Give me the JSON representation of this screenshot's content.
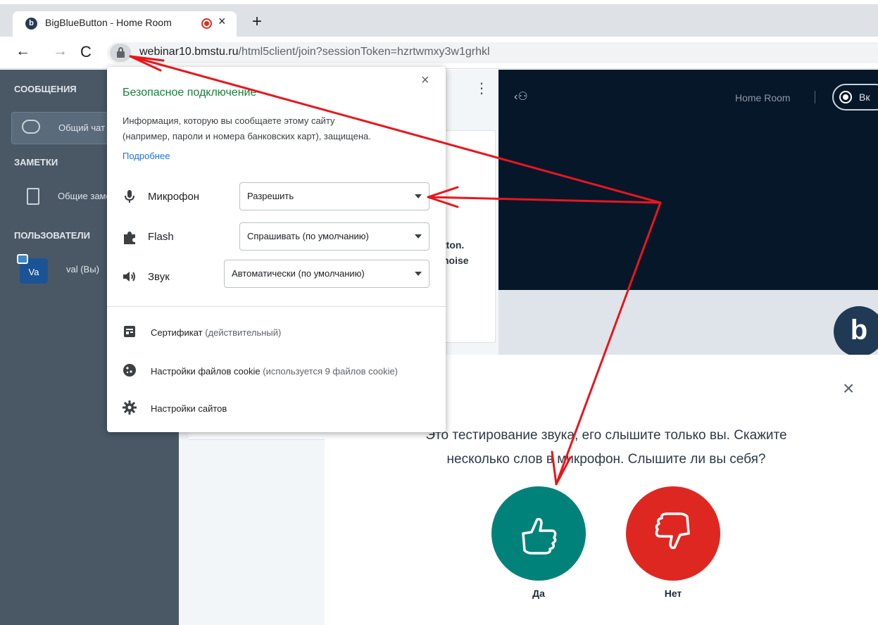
{
  "browser": {
    "tab_title": "BigBlueButton - Home Room",
    "tab_close": "×",
    "new_tab": "+",
    "url_host": "webinar10.bmstu.ru",
    "url_path": "/html5client/join?sessionToken=hzrtwmxy3w1grhkl"
  },
  "site_info": {
    "title": "Безопасное подключение",
    "info_line1": "Информация, которую вы сообщаете этому сайту",
    "info_line2": "(например, пароли и номера банковских карт), защищена.",
    "link": "Подробнее",
    "close": "×",
    "permissions": [
      {
        "label": "Микрофон",
        "value": "Разрешить"
      },
      {
        "label": "Flash",
        "value": "Спрашивать (по умолчанию)"
      },
      {
        "label": "Звук",
        "value": "Автоматически (по умолчанию)"
      }
    ],
    "certificate": "Сертификат",
    "certificate_status": "(действительный)",
    "cookies": "Настройки файлов cookie",
    "cookies_status": "(используется 9 файлов cookie)",
    "site_settings": "Настройки сайтов"
  },
  "bbb": {
    "sidebar": {
      "messages_heading": "СООБЩЕНИЯ",
      "public_chat": "Общий чат",
      "notes_heading": "ЗАМЕТКИ",
      "shared_notes": "Общие заметки",
      "users_heading": "ПОЛЬЗОВАТЕЛИ",
      "user_avatar": "Va",
      "user_name": "val (Вы)"
    },
    "chat_panel": {
      "line1": "tton.",
      "line2": "noise"
    },
    "header": {
      "room_name": "Home Room",
      "record_label": "Вк"
    },
    "echo_test": {
      "line1": "Это тестирование звука, его слышите только вы. Скажите",
      "line2": "несколько слов в микрофон. Слышите ли вы себя?",
      "yes_label": "Да",
      "no_label": "Нет",
      "close": "×"
    },
    "colors": {
      "yes": "#00827b",
      "no": "#df2721",
      "sidebar": "#4a5866",
      "annotation": "#e8161c"
    }
  },
  "icons": {
    "back": "arrow-left-icon",
    "forward": "arrow-right-icon",
    "reload": "reload-icon",
    "lock": "lock-icon",
    "thumbs_up": "thumbs-up-icon",
    "thumbs_down": "thumbs-down-icon"
  }
}
